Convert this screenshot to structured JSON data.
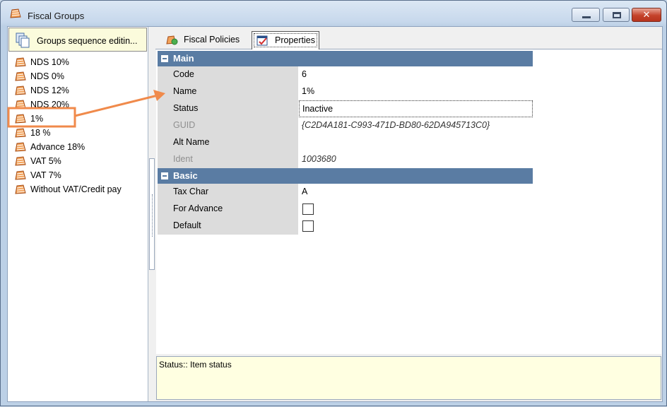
{
  "window": {
    "title": "Fiscal Groups",
    "icon": "fiscal-group-icon"
  },
  "left": {
    "sequence_button_label": "Groups sequence editin...",
    "sequence_icon": "copy-pages-icon",
    "items": [
      {
        "label": "NDS 10%"
      },
      {
        "label": "NDS 0%"
      },
      {
        "label": "NDS 12%"
      },
      {
        "label": "NDS 20%"
      },
      {
        "label": "1%"
      },
      {
        "label": "18 %"
      },
      {
        "label": "Advance 18%"
      },
      {
        "label": "VAT 5%"
      },
      {
        "label": "VAT 7%"
      },
      {
        "label": "Without VAT/Credit pay"
      }
    ],
    "highlighted_item": "1%"
  },
  "tabs": [
    {
      "label": "Fiscal Policies",
      "icon": "fiscal-policies-icon"
    },
    {
      "label": "Properties",
      "icon": "properties-icon",
      "selected": true
    }
  ],
  "properties": {
    "main": {
      "title": "Main",
      "rows": [
        {
          "name": "Code",
          "value": "6"
        },
        {
          "name": "Name",
          "value": "1%"
        },
        {
          "name": "Status",
          "value": "Inactive"
        },
        {
          "name": "GUID",
          "value": "{C2D4A181-C993-471D-BD80-62DA945713C0}"
        },
        {
          "name": "Alt Name",
          "value": ""
        },
        {
          "name": "Ident",
          "value": "1003680"
        }
      ]
    },
    "basic": {
      "title": "Basic",
      "rows": [
        {
          "name": "Tax Char",
          "value": "A"
        },
        {
          "name": "For Advance",
          "checked": false
        },
        {
          "name": "Default",
          "checked": false
        }
      ]
    }
  },
  "status_text": "Status:: Item status",
  "colors": {
    "category_header": "#5a7ca3",
    "status_bg": "#ffffe1",
    "callout": "#f08a4b"
  }
}
